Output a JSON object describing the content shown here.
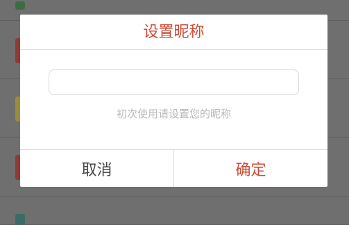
{
  "dialog": {
    "title": "设置昵称",
    "input": {
      "value": "",
      "placeholder": ""
    },
    "hint": "初次使用请设置您的昵称",
    "cancel_label": "取消",
    "confirm_label": "确定"
  },
  "colors": {
    "accent": "#cc4b36",
    "overlay_background": "#6f6f6f",
    "row_chip_colors": [
      "#3e6a46",
      "#8e3a36",
      "#9c8a3e",
      "#8e3a36",
      "#3e6a66"
    ]
  }
}
